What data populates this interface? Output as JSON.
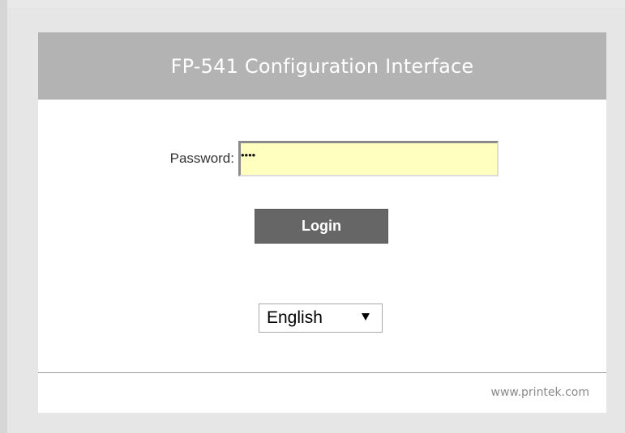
{
  "header": {
    "title": "FP-541 Configuration Interface"
  },
  "login_form": {
    "password_label": "Password:",
    "password_value_masked": "••••",
    "login_button_label": "Login"
  },
  "language": {
    "selected": "English",
    "icon": "chevron-down-icon"
  },
  "footer": {
    "link_text": "www.printek.com"
  },
  "colors": {
    "header_background": "#b3b3b3",
    "page_background": "#e6e6e6",
    "panel_background": "#ffffff",
    "input_background": "#ffffc0",
    "button_background": "#666666",
    "footer_text": "#8a8a8a"
  }
}
